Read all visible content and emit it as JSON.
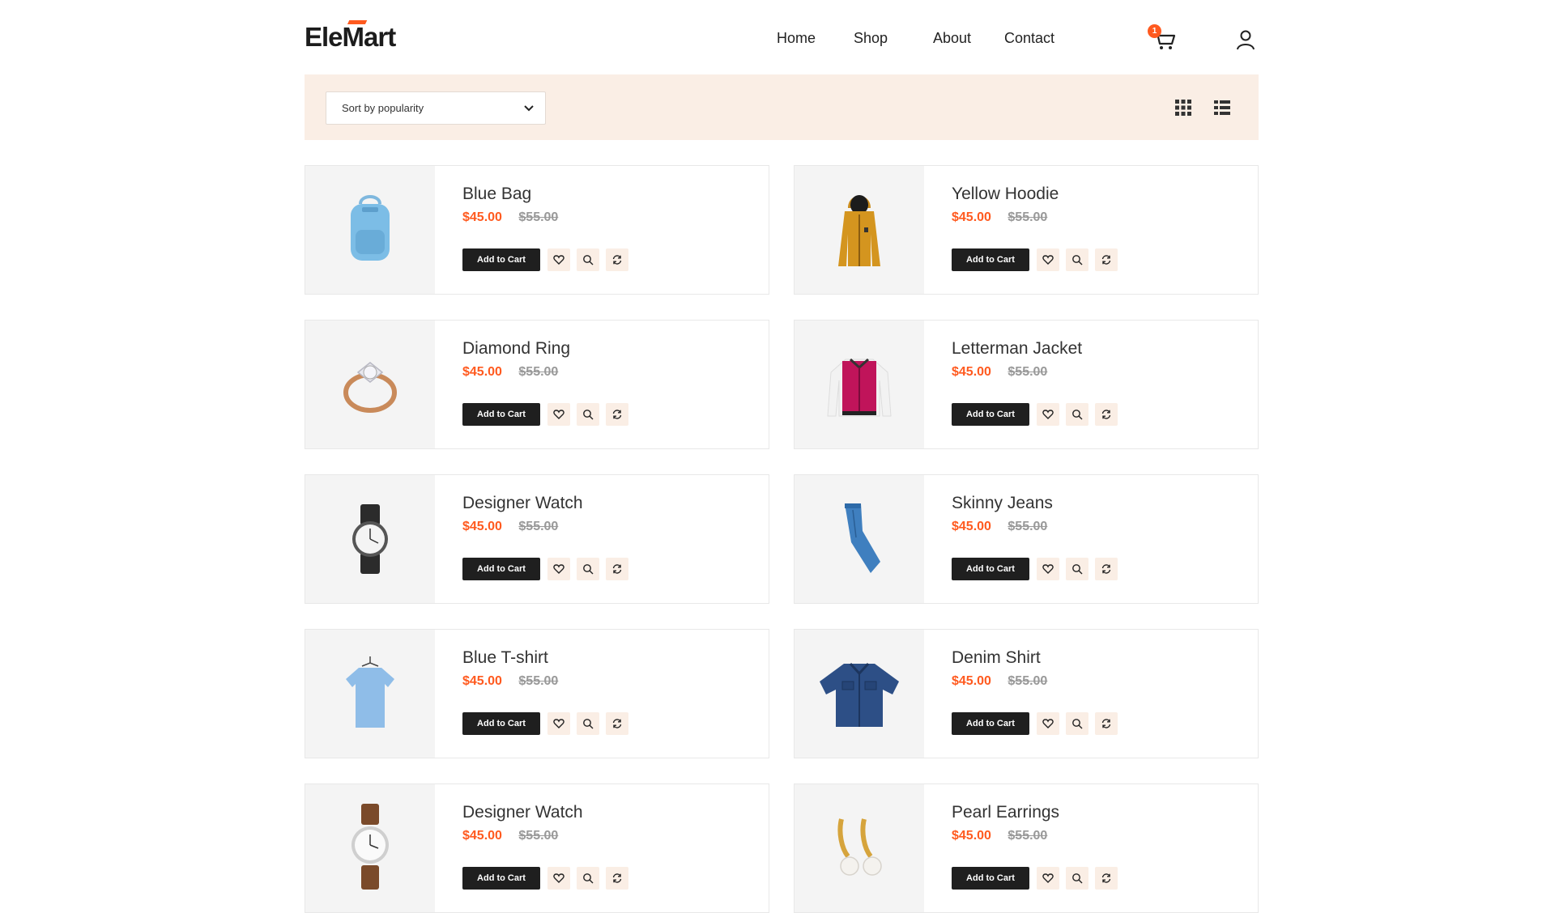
{
  "header": {
    "logo_left": "Ele",
    "logo_m": "M",
    "logo_right": "art",
    "nav": [
      "Home",
      "Shop",
      "About",
      "Contact"
    ],
    "cart_count": "1"
  },
  "toolbar": {
    "sort_value": "Sort by popularity"
  },
  "colors": {
    "accent": "#ff5a1f",
    "toolbar_bg": "#faeee5",
    "button_dark": "#1f1f1f",
    "thumb_bg": "#f4f4f4"
  },
  "products": [
    {
      "name": "Blue Bag",
      "price": "$45.00",
      "old_price": "$55.00",
      "cta": "Add to Cart",
      "image": "blue-bag"
    },
    {
      "name": "Yellow Hoodie",
      "price": "$45.00",
      "old_price": "$55.00",
      "cta": "Add to Cart",
      "image": "yellow-hoodie"
    },
    {
      "name": "Diamond Ring",
      "price": "$45.00",
      "old_price": "$55.00",
      "cta": "Add to Cart",
      "image": "diamond-ring"
    },
    {
      "name": "Letterman Jacket",
      "price": "$45.00",
      "old_price": "$55.00",
      "cta": "Add to Cart",
      "image": "letterman-jacket"
    },
    {
      "name": "Designer Watch",
      "price": "$45.00",
      "old_price": "$55.00",
      "cta": "Add to Cart",
      "image": "black-watch"
    },
    {
      "name": "Skinny Jeans",
      "price": "$45.00",
      "old_price": "$55.00",
      "cta": "Add to Cart",
      "image": "skinny-jeans"
    },
    {
      "name": "Blue T-shirt",
      "price": "$45.00",
      "old_price": "$55.00",
      "cta": "Add to Cart",
      "image": "blue-tshirt"
    },
    {
      "name": "Denim Shirt",
      "price": "$45.00",
      "old_price": "$55.00",
      "cta": "Add to Cart",
      "image": "denim-shirt"
    },
    {
      "name": "Designer Watch",
      "price": "$45.00",
      "old_price": "$55.00",
      "cta": "Add to Cart",
      "image": "brown-watch"
    },
    {
      "name": "Pearl Earrings",
      "price": "$45.00",
      "old_price": "$55.00",
      "cta": "Add to Cart",
      "image": "pearl-earrings"
    }
  ]
}
